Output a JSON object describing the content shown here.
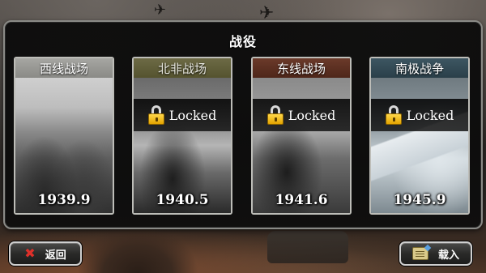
{
  "title": "战役",
  "campaigns": [
    {
      "name": "西线战场",
      "year": "1939.9",
      "locked": false
    },
    {
      "name": "北非战场",
      "year": "1940.5",
      "locked": true
    },
    {
      "name": "东线战场",
      "year": "1941.6",
      "locked": true
    },
    {
      "name": "南极战争",
      "year": "1945.9",
      "locked": true
    }
  ],
  "locked_label": "Locked",
  "buttons": {
    "back_label": "返回",
    "load_label": "载入"
  },
  "icons": {
    "back": "close-x-icon",
    "load": "notepad-icon",
    "lock": "padlock-icon"
  }
}
